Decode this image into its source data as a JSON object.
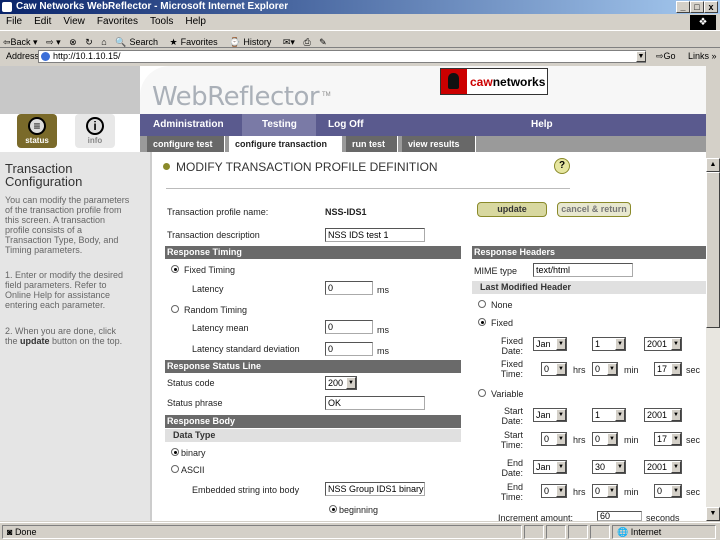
{
  "window": {
    "title": "Caw Networks WebReflector - Microsoft Internet Explorer",
    "btn_min": "_",
    "btn_max": "□",
    "btn_close": "x"
  },
  "menu": [
    "File",
    "Edit",
    "View",
    "Favorites",
    "Tools",
    "Help"
  ],
  "toolbar": {
    "back": "⇦Back ▾",
    "forward": "⇨ ▾",
    "stop": "⊗",
    "refresh": "↻",
    "home": "⌂",
    "search": "Search",
    "favorites": "Favorites",
    "history": "History"
  },
  "address": {
    "label": "Address",
    "url": "http://10.1.10.15/",
    "go": "Go",
    "links": "Links »"
  },
  "brand": {
    "product": "WebReflector",
    "tm": "TM",
    "caw": "caw",
    "networks": "networks"
  },
  "side_icons": {
    "status": "status",
    "info": "info",
    "status_glyph": "≡",
    "info_glyph": "i"
  },
  "nav_main": [
    "Administration",
    "Testing",
    "Log Off",
    "Help"
  ],
  "nav_sub": [
    "configure test",
    "configure transaction",
    "run test",
    "view results"
  ],
  "left_panel": {
    "title": "Transaction Configuration",
    "p1": "You can modify the parameters of the transaction profile from this screen. A transaction profile consists of a Transaction Type, Body, and Timing parameters.",
    "p2": "1. Enter or modify the desired field parameters. Refer to Online Help for assistance entering each parameter.",
    "p3_a": "2. When you are done, click the ",
    "p3_b": "update",
    "p3_c": " button on the top."
  },
  "page": {
    "heading": "MODIFY TRANSACTION PROFILE DEFINITION",
    "help": "?",
    "update": "update",
    "cancel": "cancel & return"
  },
  "form": {
    "profile_name_label": "Transaction profile name:",
    "profile_name": "NSS-IDS1",
    "desc_label": "Transaction description",
    "desc": "NSS IDS test 1",
    "response_timing": "Response Timing",
    "fixed_timing": "Fixed Timing",
    "latency": "Latency",
    "latency_val": "0",
    "ms": "ms",
    "random_timing": "Random Timing",
    "latency_mean": "Latency mean",
    "latency_mean_val": "0",
    "latency_sd": "Latency standard deviation",
    "latency_sd_val": "0",
    "status_line": "Response Status Line",
    "status_code_label": "Status code",
    "status_code": "200",
    "status_phrase_label": "Status phrase",
    "status_phrase": "OK",
    "response_body": "Response Body",
    "data_type": "Data Type",
    "binary": "binary",
    "ascii": "ASCII",
    "embedded_label": "Embedded string into body",
    "embedded": "NSS Group IDS1 binary",
    "beginning": "beginning"
  },
  "headers": {
    "title": "Response Headers",
    "mime_label": "MIME type",
    "mime": "text/html",
    "last_modified": "Last Modified Header",
    "none": "None",
    "fixed": "Fixed",
    "fixed_date": "Fixed Date:",
    "fixed_time": "Fixed Time:",
    "variable": "Variable",
    "start_date": "Start Date:",
    "start_time": "Start Time:",
    "end_date": "End Date:",
    "end_time": "End Time:",
    "increment": "Increment amount:",
    "increment_val": "60",
    "seconds": "seconds",
    "hrs": "hrs",
    "min": "min",
    "sec": "sec",
    "fd": {
      "month": "Jan",
      "day": "1",
      "year": "2001"
    },
    "ft": {
      "h": "0",
      "m": "0",
      "s": "17"
    },
    "sd": {
      "month": "Jan",
      "day": "1",
      "year": "2001"
    },
    "st": {
      "h": "0",
      "m": "0",
      "s": "17"
    },
    "ed": {
      "month": "Jan",
      "day": "30",
      "year": "2001"
    },
    "et": {
      "h": "0",
      "m": "0",
      "s": "0"
    }
  },
  "status": {
    "left": "Done",
    "zone": "Internet"
  }
}
